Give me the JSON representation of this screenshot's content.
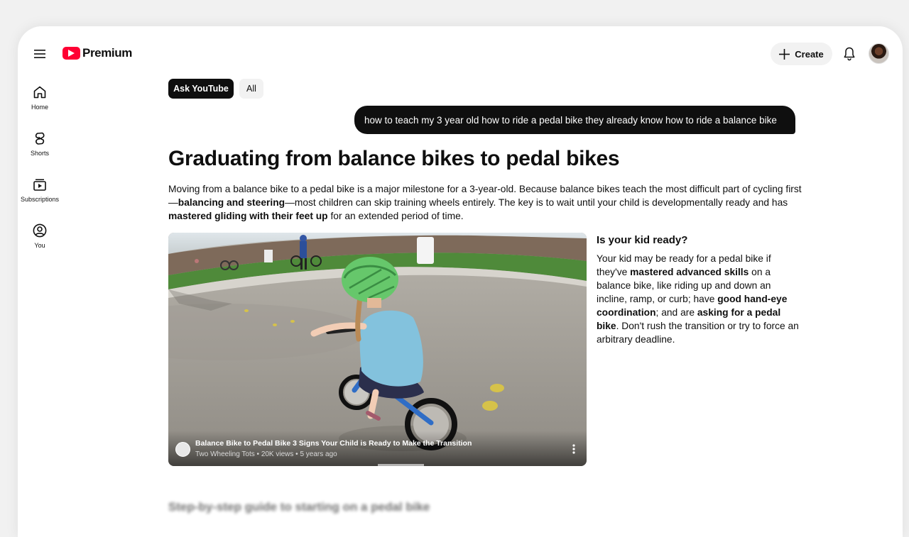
{
  "header": {
    "brand": "Premium",
    "create_label": "Create"
  },
  "sidebar": {
    "items": [
      {
        "label": "Home",
        "icon": "home-icon"
      },
      {
        "label": "Shorts",
        "icon": "shorts-icon"
      },
      {
        "label": "Subscriptions",
        "icon": "subscriptions-icon"
      },
      {
        "label": "You",
        "icon": "account-icon"
      }
    ]
  },
  "chips": [
    {
      "label": "Ask YouTube",
      "selected": true
    },
    {
      "label": "All",
      "selected": false
    }
  ],
  "query": "how to teach my 3 year old how to ride a pedal bike they already know how to ride a balance bike",
  "answer": {
    "headline": "Graduating from balance bikes to pedal bikes",
    "intro": [
      "Moving from a balance bike to a pedal bike is a major milestone for a 3-year-old. Because balance bikes teach the most difficult part of cycling first—",
      "balancing and steering",
      "—most children can skip training wheels entirely. The key is to wait until your child is developmentally ready and has ",
      "mastered gliding with their feet up",
      " for an extended period of time."
    ],
    "video": {
      "title": "Balance Bike to Pedal Bike 3 Signs Your Child is Ready to Make the Transition",
      "channel": "Two Wheeling Tots",
      "views": "20K views",
      "age": "5 years ago"
    },
    "ready": {
      "heading": "Is your kid ready?",
      "parts": [
        "Your kid may be ready for a pedal bike if they've ",
        "mastered advanced skills",
        " on a balance bike, like riding up and down an incline, ramp, or curb; have ",
        "good hand-eye coordination",
        "; and are ",
        "asking for a pedal bike",
        ". Don't rush the transition or try to force an arbitrary deadline."
      ]
    },
    "next_heading": "Step-by-step guide to starting on a pedal bike"
  },
  "colors": {
    "brand_red": "#ff0033",
    "chip_active": "#0f0f0f",
    "chip_inactive": "#f2f2f2"
  }
}
